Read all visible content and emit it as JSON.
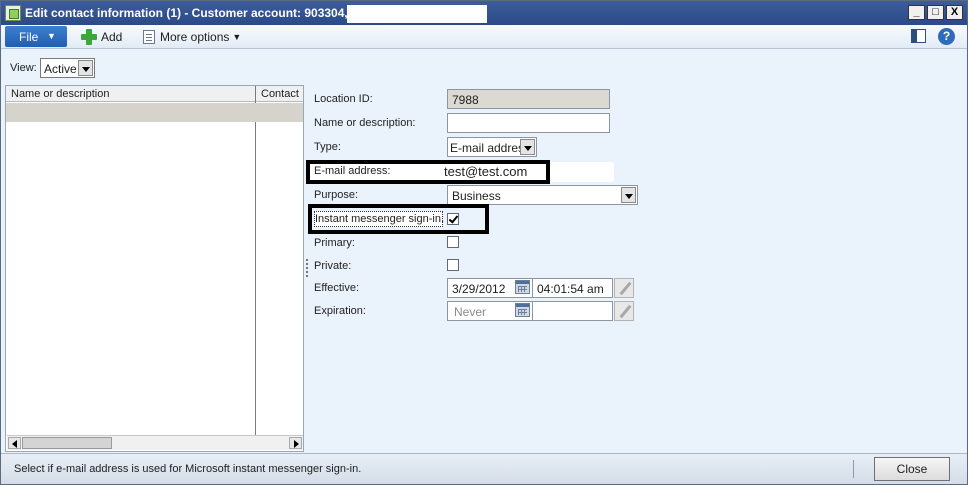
{
  "window": {
    "title": "Edit contact information (1) - Customer account: 903304,",
    "controls": {
      "minimize": "_",
      "maximize": "□",
      "close": "X"
    }
  },
  "menubar": {
    "file_label": "File",
    "add_label": "Add",
    "more_options_label": "More options",
    "icons": [
      "plus-icon",
      "document-icon",
      "layout-icon",
      "help-icon"
    ]
  },
  "view": {
    "label": "View:",
    "selected": "Active"
  },
  "grid": {
    "columns": [
      "Name or description",
      "Contact"
    ],
    "rows": [
      {
        "name": "",
        "contact": ""
      }
    ]
  },
  "form": {
    "location_id": {
      "label": "Location ID:",
      "value": "7988"
    },
    "name_description": {
      "label": "Name or description:",
      "value": ""
    },
    "type": {
      "label": "Type:",
      "value": "E-mail address"
    },
    "email": {
      "label": "E-mail address:",
      "value": "test@test.com"
    },
    "purpose": {
      "label": "Purpose:",
      "value": "Business"
    },
    "im_signin": {
      "label": "Instant messenger sign-in:",
      "checked": true
    },
    "primary": {
      "label": "Primary:",
      "checked": false
    },
    "private": {
      "label": "Private:",
      "checked": false
    },
    "effective": {
      "label": "Effective:",
      "date": "3/29/2012",
      "time": "04:01:54 am"
    },
    "expiration": {
      "label": "Expiration:",
      "date_placeholder": "Never"
    }
  },
  "status": {
    "help_text": "Select if e-mail address is used for Microsoft instant messenger sign-in.",
    "close_label": "Close"
  },
  "colors": {
    "title_bar": "#2b4a86",
    "file_button": "#1f5fb3",
    "form_background": "#eaf3fc"
  }
}
